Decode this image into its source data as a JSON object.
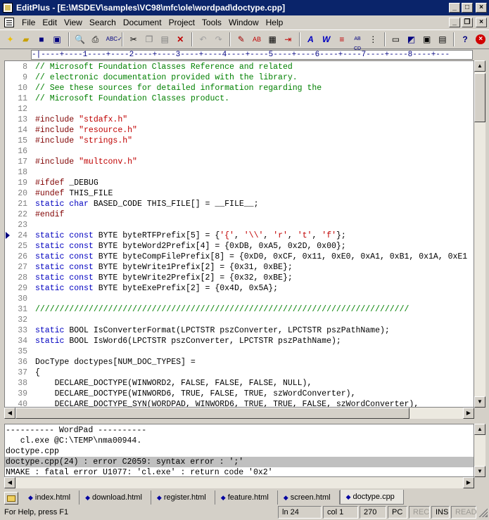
{
  "window": {
    "title": "EditPlus - [E:\\MSDEV\\samples\\VC98\\mfc\\ole\\wordpad\\doctype.cpp]"
  },
  "menu": [
    "File",
    "Edit",
    "View",
    "Search",
    "Document",
    "Project",
    "Tools",
    "Window",
    "Help"
  ],
  "toolbar": [
    "new-icon",
    "open-icon",
    "save-icon",
    "save-all-icon",
    "print-preview-icon",
    "print-icon",
    "spell-check-icon",
    "cut-icon",
    "copy-icon",
    "paste-icon",
    "delete-icon",
    "undo-icon",
    "redo-icon",
    "find-icon",
    "replace-icon",
    "copy-file-icon",
    "indent-icon",
    "font-icon",
    "word-wrap-icon",
    "line-number-icon",
    "hex-icon",
    "column-select-icon",
    "word-count-icon",
    "browser-icon",
    "clipboard-icon",
    "list-icon",
    "help-icon",
    "close-document-icon"
  ],
  "ruler": {
    "text": "-|----+----1----+----2----+----3----+----4----+----5----+----6----+----7----+----8----+---"
  },
  "editor": {
    "bookmark_line": 24,
    "lines": [
      {
        "num": "8",
        "parts": [
          {
            "t": "// Microsoft Foundation Classes Reference and related",
            "c": "comment"
          }
        ]
      },
      {
        "num": "9",
        "parts": [
          {
            "t": "// electronic documentation provided with the library.",
            "c": "comment"
          }
        ]
      },
      {
        "num": "10",
        "parts": [
          {
            "t": "// See these sources for detailed information regarding the",
            "c": "comment"
          }
        ]
      },
      {
        "num": "11",
        "parts": [
          {
            "t": "// Microsoft Foundation Classes product.",
            "c": "comment"
          }
        ]
      },
      {
        "num": "12",
        "parts": []
      },
      {
        "num": "13",
        "parts": [
          {
            "t": "#include ",
            "c": "pre"
          },
          {
            "t": "\"stdafx.h\"",
            "c": "str"
          }
        ]
      },
      {
        "num": "14",
        "parts": [
          {
            "t": "#include ",
            "c": "pre"
          },
          {
            "t": "\"resource.h\"",
            "c": "str"
          }
        ]
      },
      {
        "num": "15",
        "parts": [
          {
            "t": "#include ",
            "c": "pre"
          },
          {
            "t": "\"strings.h\"",
            "c": "str"
          }
        ]
      },
      {
        "num": "16",
        "parts": []
      },
      {
        "num": "17",
        "parts": [
          {
            "t": "#include ",
            "c": "pre"
          },
          {
            "t": "\"multconv.h\"",
            "c": "str"
          }
        ]
      },
      {
        "num": "18",
        "parts": []
      },
      {
        "num": "19",
        "parts": [
          {
            "t": "#ifdef ",
            "c": "pre"
          },
          {
            "t": "_DEBUG",
            "c": "plain"
          }
        ]
      },
      {
        "num": "20",
        "parts": [
          {
            "t": "#undef ",
            "c": "pre"
          },
          {
            "t": "THIS_FILE",
            "c": "plain"
          }
        ]
      },
      {
        "num": "21",
        "parts": [
          {
            "t": "static char ",
            "c": "kw"
          },
          {
            "t": "BASED_CODE THIS_FILE[] = __FILE__;",
            "c": "plain"
          }
        ]
      },
      {
        "num": "22",
        "parts": [
          {
            "t": "#endif",
            "c": "pre"
          }
        ]
      },
      {
        "num": "23",
        "parts": []
      },
      {
        "num": "24",
        "parts": [
          {
            "t": "static const ",
            "c": "kw"
          },
          {
            "t": "BYTE byteRTFPrefix[5] = {",
            "c": "plain"
          },
          {
            "t": "'{'",
            "c": "str"
          },
          {
            "t": ", ",
            "c": "plain"
          },
          {
            "t": "'\\\\'",
            "c": "str"
          },
          {
            "t": ", ",
            "c": "plain"
          },
          {
            "t": "'r'",
            "c": "str"
          },
          {
            "t": ", ",
            "c": "plain"
          },
          {
            "t": "'t'",
            "c": "str"
          },
          {
            "t": ", ",
            "c": "plain"
          },
          {
            "t": "'f'",
            "c": "str"
          },
          {
            "t": "};",
            "c": "plain"
          }
        ]
      },
      {
        "num": "25",
        "parts": [
          {
            "t": "static const ",
            "c": "kw"
          },
          {
            "t": "BYTE byteWord2Prefix[4] = {0xDB, 0xA5, 0x2D, 0x00};",
            "c": "plain"
          }
        ]
      },
      {
        "num": "26",
        "parts": [
          {
            "t": "static const ",
            "c": "kw"
          },
          {
            "t": "BYTE byteCompFilePrefix[8] = {0xD0, 0xCF, 0x11, 0xE0, 0xA1, 0xB1, 0x1A, 0xE1",
            "c": "plain"
          }
        ]
      },
      {
        "num": "27",
        "parts": [
          {
            "t": "static const ",
            "c": "kw"
          },
          {
            "t": "BYTE byteWrite1Prefix[2] = {0x31, 0xBE};",
            "c": "plain"
          }
        ]
      },
      {
        "num": "28",
        "parts": [
          {
            "t": "static const ",
            "c": "kw"
          },
          {
            "t": "BYTE byteWrite2Prefix[2] = {0x32, 0xBE};",
            "c": "plain"
          }
        ]
      },
      {
        "num": "29",
        "parts": [
          {
            "t": "static const ",
            "c": "kw"
          },
          {
            "t": "BYTE byteExePrefix[2] = {0x4D, 0x5A};",
            "c": "plain"
          }
        ]
      },
      {
        "num": "30",
        "parts": []
      },
      {
        "num": "31",
        "parts": [
          {
            "t": "/////////////////////////////////////////////////////////////////////////////",
            "c": "comment"
          }
        ]
      },
      {
        "num": "32",
        "parts": []
      },
      {
        "num": "33",
        "parts": [
          {
            "t": "static ",
            "c": "kw"
          },
          {
            "t": "BOOL IsConverterFormat(LPCTSTR pszConverter, LPCTSTR pszPathName);",
            "c": "plain"
          }
        ]
      },
      {
        "num": "34",
        "parts": [
          {
            "t": "static ",
            "c": "kw"
          },
          {
            "t": "BOOL IsWord6(LPCTSTR pszConverter, LPCTSTR pszPathName);",
            "c": "plain"
          }
        ]
      },
      {
        "num": "35",
        "parts": []
      },
      {
        "num": "36",
        "parts": [
          {
            "t": "DocType doctypes[NUM_DOC_TYPES] =",
            "c": "plain"
          }
        ]
      },
      {
        "num": "37",
        "parts": [
          {
            "t": "{",
            "c": "plain"
          }
        ]
      },
      {
        "num": "38",
        "parts": [
          {
            "t": "    DECLARE_DOCTYPE(WINWORD2, FALSE, FALSE, FALSE, NULL),",
            "c": "plain"
          }
        ]
      },
      {
        "num": "39",
        "parts": [
          {
            "t": "    DECLARE_DOCTYPE(WINWORD6, TRUE, FALSE, TRUE, szWordConverter),",
            "c": "plain"
          }
        ]
      },
      {
        "num": "40",
        "parts": [
          {
            "t": "    DECLARE_DOCTYPE_SYN(WORDPAD, WINWORD6, TRUE, TRUE, FALSE, szWordConverter),",
            "c": "plain"
          }
        ]
      }
    ]
  },
  "output": {
    "lines": [
      {
        "text": "---------- WordPad ----------",
        "highlight": false
      },
      {
        "text": "   cl.exe @C:\\TEMP\\nma00944.",
        "highlight": false
      },
      {
        "text": "doctype.cpp",
        "highlight": false
      },
      {
        "text": "doctype.cpp(24) : error C2059: syntax error : ';'",
        "highlight": true
      },
      {
        "text": "NMAKE : fatal error U1077: 'cl.exe' : return code '0x2'",
        "highlight": false
      }
    ]
  },
  "tabs": [
    {
      "label": "index.html",
      "active": false
    },
    {
      "label": "download.html",
      "active": false
    },
    {
      "label": "register.html",
      "active": false
    },
    {
      "label": "feature.html",
      "active": false
    },
    {
      "label": "screen.html",
      "active": false
    },
    {
      "label": "doctype.cpp",
      "active": true
    }
  ],
  "status": {
    "help": "For Help, press F1",
    "line": "ln 24",
    "col": "col 1",
    "total": "270",
    "format": "PC",
    "rec": "REC",
    "ins": "INS",
    "read": "READ"
  }
}
